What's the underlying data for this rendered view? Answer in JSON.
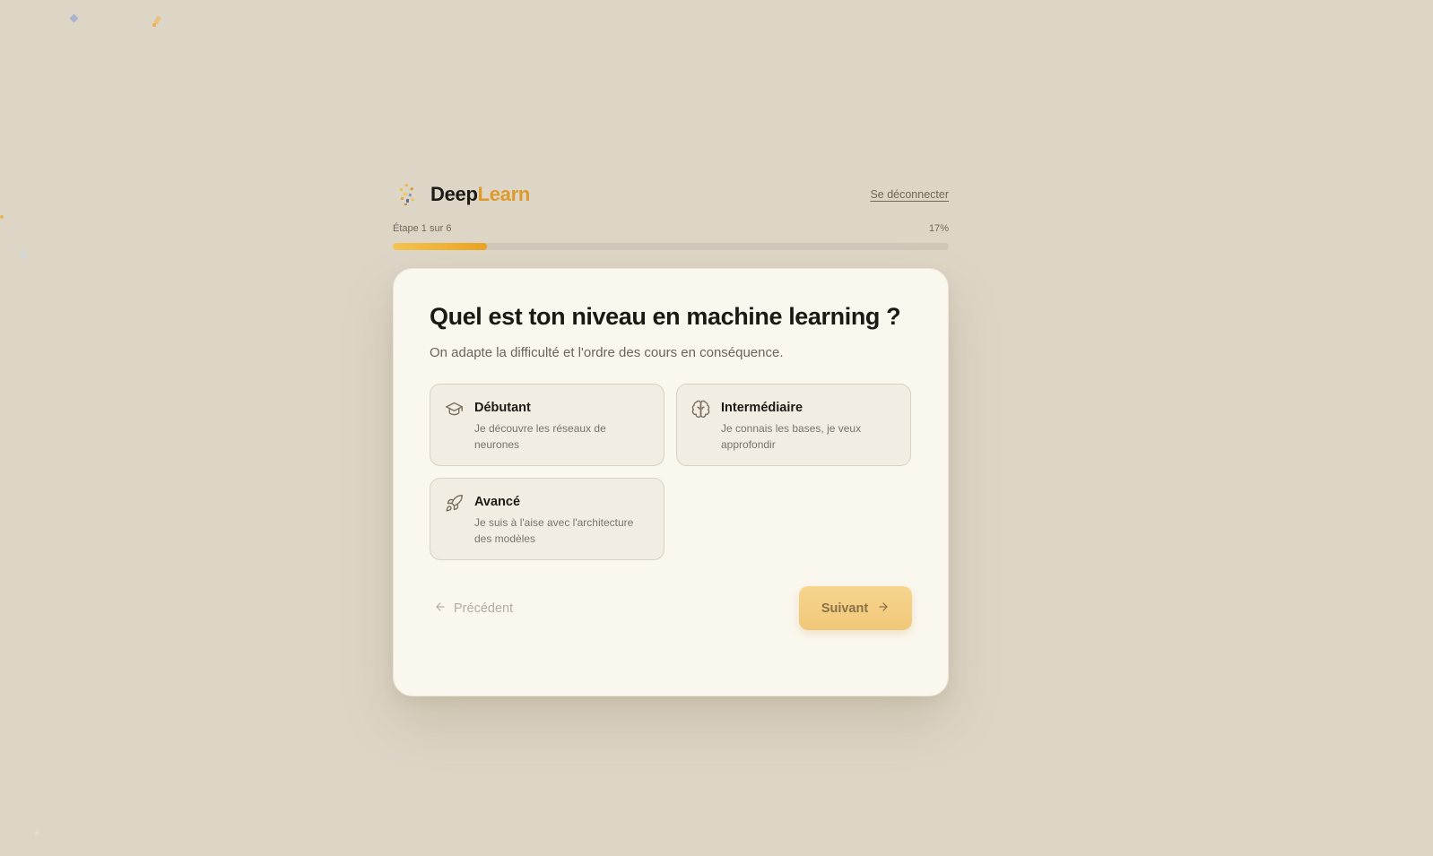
{
  "brand": {
    "name_part1": "Deep",
    "name_part2": "Learn",
    "logo_icon": "confetti-sparkle-icon",
    "accent_color": "#dd9a2c"
  },
  "header": {
    "logout_label": "Se déconnecter"
  },
  "progress": {
    "step_label": "Étape 1 sur 6",
    "percent_label": "17%",
    "fraction": 0.17
  },
  "question": {
    "title": "Quel est ton niveau en machine learning ?",
    "subtitle": "On adapte la difficulté et l'ordre des cours en conséquence."
  },
  "options": [
    {
      "title": "Débutant",
      "description": "Je découvre les réseaux de neurones",
      "icon": "graduation-cap-icon"
    },
    {
      "title": "Intermédiaire",
      "description": "Je connais les bases, je veux approfondir",
      "icon": "brain-icon"
    },
    {
      "title": "Avancé",
      "description": "Je suis à l'aise avec l'architecture des modèles",
      "icon": "rocket-icon"
    }
  ],
  "navigation": {
    "prev_label": "Précédent",
    "next_label": "Suivant"
  }
}
